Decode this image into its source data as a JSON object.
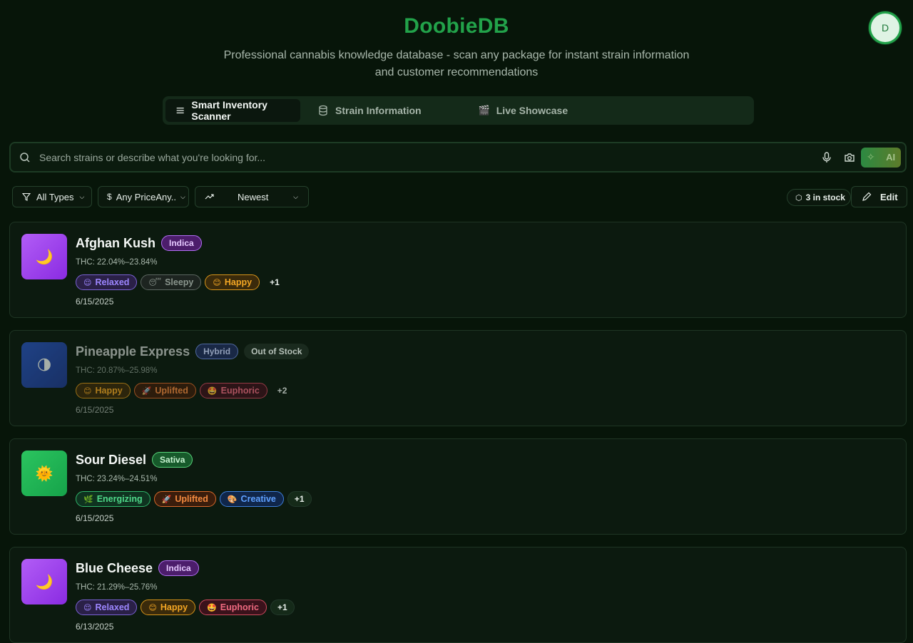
{
  "app": {
    "title": "DoobieDB",
    "subtitle": "Professional cannabis knowledge database - scan any package for instant strain information and customer recommendations",
    "avatar_letter": "D"
  },
  "tabs": [
    {
      "label": "Smart Inventory Scanner",
      "icon": "menu-icon",
      "active": true
    },
    {
      "label": "Strain Information",
      "icon": "database-icon",
      "active": false
    },
    {
      "label": "Live Showcase",
      "icon": "clapper-icon",
      "active": false
    }
  ],
  "search": {
    "placeholder": "Search strains or describe what you're looking for...",
    "ai_label": "AI"
  },
  "filters": {
    "type_label": "All Types",
    "price_label": "Any PriceAny..",
    "sort_label": "Newest",
    "stock_label": "3 in stock",
    "edit_label": "Edit"
  },
  "strains": [
    {
      "name": "Afghan Kush",
      "type": "Indica",
      "thc": "THC: 22.04%–23.84%",
      "status": "",
      "emoji": "🌙",
      "effects": [
        {
          "label": "Relaxed",
          "emoji": "😌",
          "kind": "relaxed"
        },
        {
          "label": "Sleepy",
          "emoji": "😴",
          "kind": "sleepy"
        },
        {
          "label": "Happy",
          "emoji": "😊",
          "kind": "happy"
        }
      ],
      "more": "+1",
      "date": "6/15/2025"
    },
    {
      "name": "Pineapple Express",
      "type": "Hybrid",
      "thc": "THC: 20.87%–25.98%",
      "status": "Out of Stock",
      "emoji": "🌗",
      "effects": [
        {
          "label": "Happy",
          "emoji": "😊",
          "kind": "happy"
        },
        {
          "label": "Uplifted",
          "emoji": "🚀",
          "kind": "uplifted"
        },
        {
          "label": "Euphoric",
          "emoji": "🤩",
          "kind": "euphoric"
        }
      ],
      "more": "+2",
      "date": "6/15/2025"
    },
    {
      "name": "Sour Diesel",
      "type": "Sativa",
      "thc": "THC: 23.24%–24.51%",
      "status": "",
      "emoji": "🌞",
      "effects": [
        {
          "label": "Energizing",
          "emoji": "🌿",
          "kind": "energizing"
        },
        {
          "label": "Uplifted",
          "emoji": "🚀",
          "kind": "uplifted"
        },
        {
          "label": "Creative",
          "emoji": "🎨",
          "kind": "creative"
        }
      ],
      "more": "+1",
      "date": "6/15/2025"
    },
    {
      "name": "Blue Cheese",
      "type": "Indica",
      "thc": "THC: 21.29%–25.76%",
      "status": "",
      "emoji": "🌙",
      "effects": [
        {
          "label": "Relaxed",
          "emoji": "😌",
          "kind": "relaxed"
        },
        {
          "label": "Happy",
          "emoji": "😊",
          "kind": "happy"
        },
        {
          "label": "Euphoric",
          "emoji": "🤩",
          "kind": "euphoric"
        }
      ],
      "more": "+1",
      "date": "6/13/2025"
    }
  ],
  "colors": {
    "brand": "#22a24a",
    "indica": "#a855f7",
    "hybrid": "#1e40af",
    "sativa": "#22c55e",
    "background": "#071509"
  }
}
